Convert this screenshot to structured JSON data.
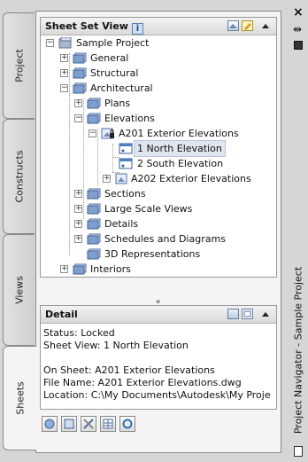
{
  "tabs": [
    {
      "label": "Project"
    },
    {
      "label": "Constructs"
    },
    {
      "label": "Views"
    },
    {
      "label": "Sheets"
    }
  ],
  "sheet_set_view": {
    "title": "Sheet Set View",
    "tree": {
      "root": "Sample Project",
      "general": "General",
      "structural": "Structural",
      "architectural": "Architectural",
      "plans": "Plans",
      "elevations": "Elevations",
      "a201": "A201 Exterior Elevations",
      "north": "1 North Elevation",
      "south": "2 South Elevation",
      "a202": "A202 Exterior Elevations",
      "sections": "Sections",
      "large_scale": "Large Scale Views",
      "details": "Details",
      "schedules": "Schedules and Diagrams",
      "rep3d": "3D Representations",
      "interiors": "Interiors"
    }
  },
  "detail": {
    "title": "Detail",
    "status": "Status: Locked",
    "sheet_view": "Sheet View: 1 North Elevation",
    "on_sheet": "On Sheet: A201 Exterior Elevations",
    "file_name": "File Name: A201 Exterior Elevations.dwg",
    "location": "Location: C:\\My Documents\\Autodesk\\My Proje"
  },
  "palette_title": "Project Navigator - Sample Project",
  "right_controls": {
    "close": "×",
    "pin": "⇹"
  },
  "colors": {
    "folder_blue": "#5b86c4",
    "selection": "#dfe6ef"
  }
}
